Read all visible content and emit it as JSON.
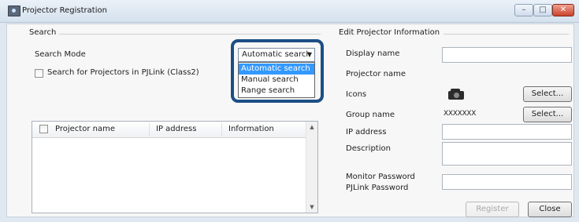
{
  "window": {
    "title": "Projector Registration",
    "controls": {
      "minimize": "–",
      "maximize": "□",
      "close": "✕"
    }
  },
  "search": {
    "group_title": "Search",
    "mode_label": "Search Mode",
    "mode_selected": "Automatic search",
    "mode_options": [
      "Automatic search",
      "Manual search",
      "Range search"
    ],
    "pjlink_checkbox_label": "Search for Projectors in PJLink (Class2)",
    "pjlink_checked": false
  },
  "results_table": {
    "columns": [
      "Projector name",
      "IP address",
      "Information"
    ],
    "rows": []
  },
  "edit": {
    "group_title": "Edit Projector Information",
    "display_name_label": "Display name",
    "projector_name_label": "Projector name",
    "icons_label": "Icons",
    "icon_select_button": "Select...",
    "group_name_label": "Group name",
    "group_name_value": "XXXXXXX",
    "group_select_button": "Select...",
    "ip_address_label": "IP address",
    "description_label": "Description",
    "monitor_password_label": "Monitor Password",
    "pjlink_password_label": "PJLink Password",
    "register_button": "Register",
    "close_button": "Close"
  },
  "icons": {
    "projector": "projector-icon",
    "app": "projector-app-icon"
  },
  "colors": {
    "selection": "#3399ff",
    "highlight_border": "#1c4e86",
    "close_button": "#c8432c"
  }
}
